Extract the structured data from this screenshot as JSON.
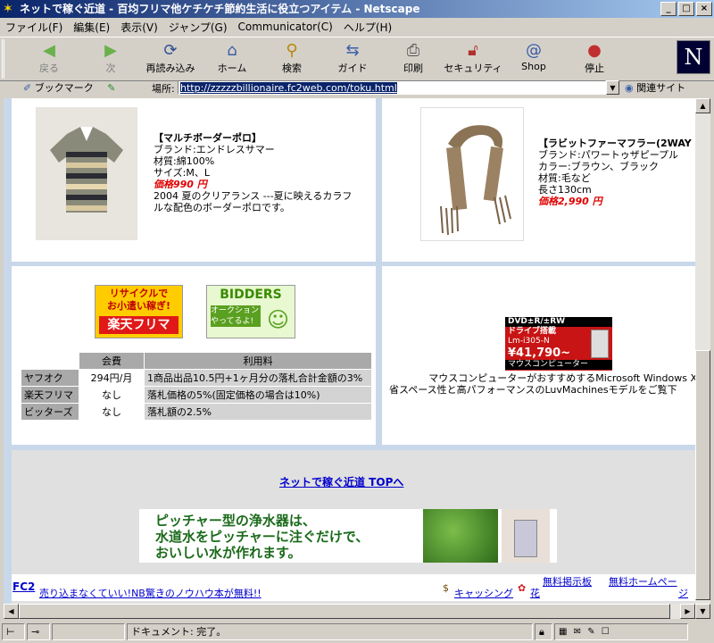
{
  "window": {
    "title": "ネットで稼ぐ近道 - 百均フリマ他ケチケチ節約生活に役立つアイテム - Netscape",
    "icon": "netscape-star-icon"
  },
  "menu": [
    "ファイル(F)",
    "編集(E)",
    "表示(V)",
    "ジャンプ(G)",
    "Communicator(C)",
    "ヘルプ(H)"
  ],
  "toolbar": [
    {
      "label": "戻る",
      "icon": "back-arrow-icon"
    },
    {
      "label": "次",
      "icon": "forward-arrow-icon"
    },
    {
      "label": "再読み込み",
      "icon": "reload-icon"
    },
    {
      "label": "ホーム",
      "icon": "home-icon"
    },
    {
      "label": "検索",
      "icon": "search-icon"
    },
    {
      "label": "ガイド",
      "icon": "guide-icon"
    },
    {
      "label": "印刷",
      "icon": "print-icon"
    },
    {
      "label": "セキュリティ",
      "icon": "security-lock-icon"
    },
    {
      "label": "Shop",
      "icon": "shop-icon"
    },
    {
      "label": "停止",
      "icon": "stop-icon"
    }
  ],
  "location": {
    "bookmarks_label": "ブックマーク",
    "label": "場所:",
    "url": "http://zzzzzbillionaire.fc2web.com/toku.html",
    "related_label": "関連サイト"
  },
  "products": {
    "polo": {
      "title": "【マルチボーダーポロ】",
      "lines": [
        "ブランド:エンドレスサマー",
        "材質:綿100%",
        "サイズ:M、L"
      ],
      "price": "価格990 円",
      "desc1": "2004 夏のクリアランス ---夏に映えるカラフ",
      "desc2": "ルな配色のボーダーポロです。"
    },
    "muffler": {
      "title": "【ラビットファーマフラー(2WAY",
      "lines": [
        "ブランド:パワートゥザピープル",
        "カラー:ブラウン、ブラック",
        "材質:毛など",
        "長さ130cm"
      ],
      "price": "価格2,990 円"
    }
  },
  "banners": {
    "rakuten_line1": "リサイクルで",
    "rakuten_line2": "お小遣い稼ぎ!",
    "rakuten_line3": "楽天フリマ",
    "bidders_logo": "BIDDERS",
    "bidders_line1": "オークション",
    "bidders_line2": "やってるよ!",
    "mouse_line1": "DVD±R/±RW",
    "mouse_line2": "ドライブ搭載",
    "mouse_model": "Lm-i305-N",
    "mouse_price": "¥41,790~",
    "mouse_brand": "マウスコンピューター",
    "mouse_text1": "マウスコンピューターがおすすめするMicrosoft Windows X",
    "mouse_text2": "省スペース性と高パフォーマンスのLuvMachinesモデルをご覧下"
  },
  "fees": {
    "headers": [
      "",
      "会費",
      "利用料"
    ],
    "rows": [
      {
        "name": "ヤフオク",
        "fee": "294円/月",
        "usage": "1商品出品10.5円+1ヶ月分の落札合計金額の3%"
      },
      {
        "name": "楽天フリマ",
        "fee": "なし",
        "usage": "落札価格の5%(固定価格の場合は10%)"
      },
      {
        "name": "ビッターズ",
        "fee": "なし",
        "usage": "落札額の2.5%"
      }
    ]
  },
  "top_link": "ネットで稼ぐ近道 TOPへ",
  "water_ad": {
    "line1": "ピッチャー型の浄水器は、",
    "line2": "水道水をピッチャーに注ぐだけで、",
    "line3": "おいしい水が作れます。"
  },
  "footer": {
    "fc2": "FC2",
    "ad_link": "売り込まなくていい!NB驚きのノウハウ本が無料!!",
    "cashing": "キャッシング",
    "flower": "花",
    "bbs": "無料掲示板",
    "homepage": "無料ホームペー",
    "homepage2": "ジ"
  },
  "status": {
    "text": "ドキュメント: 完了。"
  },
  "colors": {
    "page_bg": "#c8d8ea",
    "price_red": "#e00000",
    "link": "#0000cc",
    "title_start": "#0a246a",
    "title_end": "#a6caf0"
  }
}
